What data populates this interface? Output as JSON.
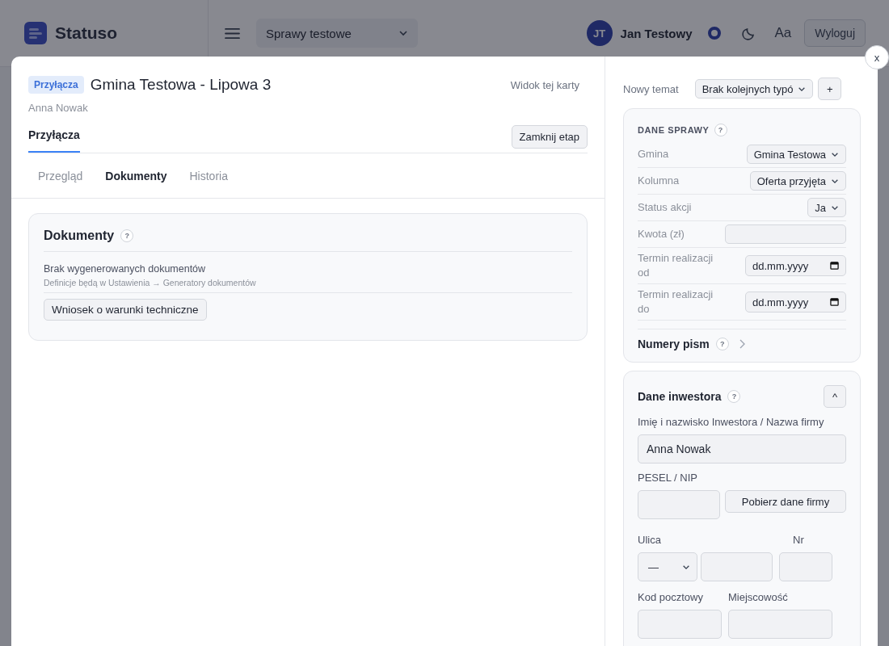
{
  "header": {
    "logo_text": "Statuso",
    "project_select": "Sprawy testowe",
    "user": {
      "initials": "JT",
      "name": "Jan Testowy"
    },
    "font_button": "Aa",
    "logout_button": "Wyloguj"
  },
  "modal": {
    "close_button": "x",
    "tag": "Przyłącza",
    "title": "Gmina Testowa - Lipowa 3",
    "subtitle": "Anna Nowak",
    "view_link": "Widok tej karty",
    "stage_tabs": [
      {
        "label": "Przyłącza",
        "selected": true
      }
    ],
    "close_stage_button": "Zamknij etap",
    "tabs": [
      {
        "label": "Przegląd",
        "selected": false
      },
      {
        "label": "Dokumenty",
        "selected": true
      },
      {
        "label": "Historia",
        "selected": false
      }
    ],
    "documents": {
      "title": "Dokumenty",
      "help": "?",
      "empty_text": "Brak wygenerowanych dokumentów",
      "hint": "Definicje będą w Ustawienia → Generatory dokumentów",
      "buttons": [
        "Wniosek o warunki techniczne"
      ]
    }
  },
  "sidebar": {
    "new_topic": {
      "label": "Nowy temat",
      "value": "Brak kolejnych typó",
      "add_button": "+"
    },
    "case_data": {
      "title": "DANE SPRAWY",
      "help": "?",
      "fields": [
        {
          "label": "Gmina",
          "kind": "select",
          "value": "Gmina Testowa"
        },
        {
          "label": "Kolumna",
          "kind": "select",
          "value": "Oferta przyjęta"
        },
        {
          "label": "Status akcji",
          "kind": "select",
          "value": "Ja"
        },
        {
          "label": "Kwota (zł)",
          "kind": "input"
        },
        {
          "label": "Termin realizacji od",
          "kind": "date",
          "placeholder": "dd.mm.yyyy"
        },
        {
          "label": "Termin realizacji do",
          "kind": "date",
          "placeholder": "dd.mm.yyyy"
        }
      ],
      "letter_numbers": {
        "title": "Numery pism",
        "help": "?"
      }
    },
    "investor": {
      "title": "Dane inwestora",
      "help": "?",
      "collapse_button": "^",
      "name_label": "Imię i nazwisko Inwestora / Nazwa firmy",
      "name_value": "Anna Nowak",
      "pesel_label": "PESEL / NIP",
      "fetch_button": "Pobierz dane firmy",
      "street_label": "Ulica",
      "street_prefix": "—",
      "number_label": "Nr",
      "postal_label": "Kod pocztowy",
      "city_label": "Miejscowość"
    }
  }
}
